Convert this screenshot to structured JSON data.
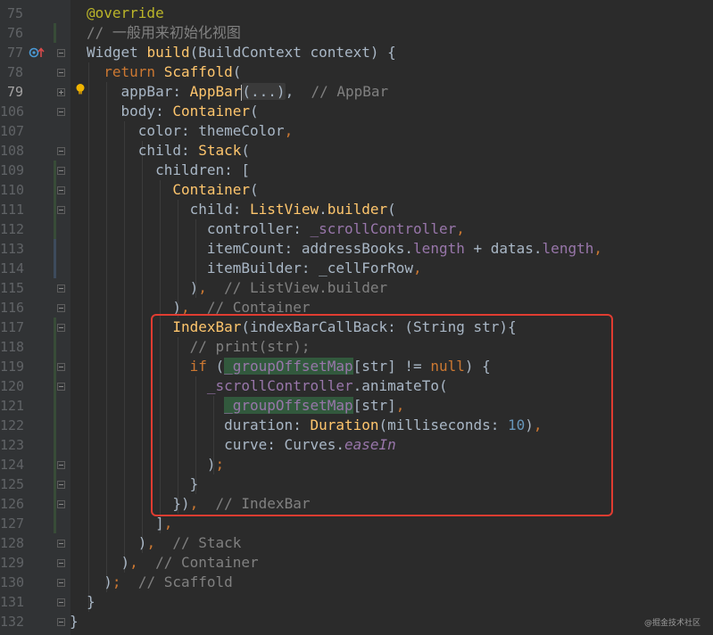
{
  "editor": {
    "lines": [
      {
        "num": "75",
        "text": "@override"
      },
      {
        "num": "76",
        "text": "// 一般用来初始化视图"
      },
      {
        "num": "77",
        "text": "Widget build(BuildContext context) {"
      },
      {
        "num": "78",
        "text": "  return Scaffold("
      },
      {
        "num": "79",
        "text": "    appBar: AppBar(...),  // AppBar"
      },
      {
        "num": "106",
        "text": "    body: Container("
      },
      {
        "num": "107",
        "text": "      color: themeColor,"
      },
      {
        "num": "108",
        "text": "      child: Stack("
      },
      {
        "num": "109",
        "text": "        children: ["
      },
      {
        "num": "110",
        "text": "          Container("
      },
      {
        "num": "111",
        "text": "            child: ListView.builder("
      },
      {
        "num": "112",
        "text": "              controller: _scrollController,"
      },
      {
        "num": "113",
        "text": "              itemCount: addressBooks.length + datas.length,"
      },
      {
        "num": "114",
        "text": "              itemBuilder: _cellForRow,"
      },
      {
        "num": "115",
        "text": "            ),  // ListView.builder"
      },
      {
        "num": "116",
        "text": "          ),  // Container"
      },
      {
        "num": "117",
        "text": "          IndexBar(indexBarCallBack: (String str){"
      },
      {
        "num": "118",
        "text": "            // print(str);"
      },
      {
        "num": "119",
        "text": "            if (_groupOffsetMap[str] != null) {"
      },
      {
        "num": "120",
        "text": "              _scrollController.animateTo("
      },
      {
        "num": "121",
        "text": "                _groupOffsetMap[str],"
      },
      {
        "num": "122",
        "text": "                duration: Duration(milliseconds: 10),"
      },
      {
        "num": "123",
        "text": "                curve: Curves.easeIn"
      },
      {
        "num": "124",
        "text": "              );"
      },
      {
        "num": "125",
        "text": "            }"
      },
      {
        "num": "126",
        "text": "          }),  // IndexBar"
      },
      {
        "num": "127",
        "text": "        ],"
      },
      {
        "num": "128",
        "text": "      ),  // Stack"
      },
      {
        "num": "129",
        "text": "    ),  // Container"
      },
      {
        "num": "130",
        "text": "  );  // Scaffold"
      },
      {
        "num": "131",
        "text": "}"
      },
      {
        "num": "132",
        "text": "}"
      }
    ],
    "current_line": "79",
    "watermark": "@掘金技术社区",
    "colors": {
      "background": "#2b2b2b",
      "gutter": "#313335",
      "keyword": "#cc7832",
      "function": "#ffc66d",
      "comment": "#808080",
      "number": "#6897bb",
      "field": "#9876aa",
      "annotation": "#bbb529",
      "highlight_box": "#e03c31"
    },
    "icons": {
      "gutter_override": "override-method-icon",
      "gutter_bulb": "lightbulb-icon"
    }
  }
}
